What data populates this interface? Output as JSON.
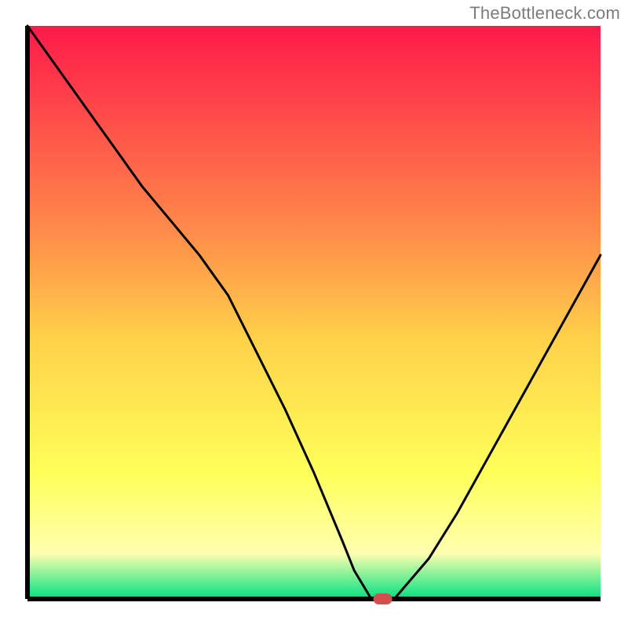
{
  "attribution": "TheBottleneck.com",
  "colors": {
    "gradient_top": "#ff1a4a",
    "gradient_upper_mid": "#ff884a",
    "gradient_mid": "#ffd24a",
    "gradient_lower_mid": "#ffff5a",
    "gradient_pale": "#ffffb0",
    "gradient_bottom": "#00e080",
    "axis": "#000000",
    "curve": "#000000",
    "marker_fill": "#d24f4f",
    "marker_stroke": "#d24f4f"
  },
  "chart_data": {
    "type": "line",
    "title": "",
    "xlabel": "",
    "ylabel": "",
    "xlim": [
      0,
      100
    ],
    "ylim": [
      0,
      100
    ],
    "x": [
      0,
      5,
      10,
      15,
      20,
      25,
      30,
      35,
      40,
      45,
      50,
      55,
      57,
      60,
      62,
      64,
      70,
      75,
      80,
      85,
      90,
      95,
      100
    ],
    "values": [
      100,
      93,
      86,
      79,
      72,
      66,
      60,
      53,
      43,
      33,
      22,
      10,
      5,
      0,
      0,
      0,
      7,
      15,
      24,
      33,
      42,
      51,
      60
    ],
    "marker": {
      "x": 62,
      "y": 0
    },
    "note": "Values are percent of plot-area height from bottom (0) to top (100), estimated from pixel positions; x is percent of plot-area width."
  }
}
